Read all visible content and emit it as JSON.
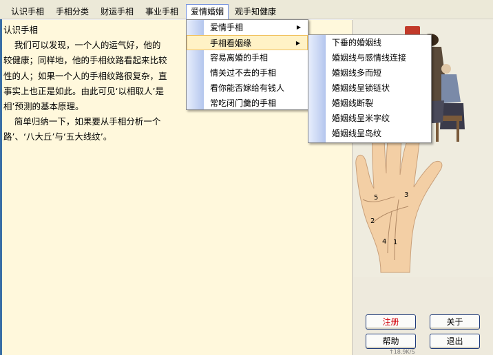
{
  "menubar": {
    "items": [
      {
        "label": "认识手相"
      },
      {
        "label": "手相分类"
      },
      {
        "label": "财运手相"
      },
      {
        "label": "事业手相"
      },
      {
        "label": "爱情婚姻"
      },
      {
        "label": "观手知健康"
      }
    ],
    "active_index": 4
  },
  "document": {
    "title": "认识手相",
    "lines": [
      "    我们可以发现，一个人的运气好，他的",
      "较健康；同样地，他的手相纹路看起来比较",
      "性的人；如果一个人的手相纹路很复杂，直",
      "事实上也正是如此。由此可见‘以相取人’是",
      "相’预测的基本原理。",
      "    简单归纳一下，如果要从手相分析一个",
      "路’、‘八大丘’与‘五大线纹’。"
    ]
  },
  "love_menu": {
    "items": [
      {
        "label": "爱情手相",
        "has_submenu": true
      },
      {
        "label": "手相看姻缘",
        "has_submenu": true,
        "highlighted": true
      },
      {
        "label": "容易离婚的手相",
        "has_submenu": false
      },
      {
        "label": "情关过不去的手相",
        "has_submenu": false
      },
      {
        "label": "看你能否嫁给有钱人",
        "has_submenu": false
      },
      {
        "label": "常吃闭门羹的手相",
        "has_submenu": false
      }
    ]
  },
  "marriage_submenu": {
    "items": [
      {
        "label": "下垂的婚姻线"
      },
      {
        "label": "婚姻线与感情线连接"
      },
      {
        "label": "婚姻线多而短"
      },
      {
        "label": "婚姻线呈锁链状"
      },
      {
        "label": "婚姻线断裂"
      },
      {
        "label": "婚姻线呈米字纹"
      },
      {
        "label": "婚姻线呈岛纹"
      }
    ]
  },
  "palm": {
    "line_numbers": [
      "1",
      "2",
      "3",
      "4",
      "5"
    ]
  },
  "buttons": {
    "register": "注册",
    "about": "关于",
    "help": "帮助",
    "exit": "退出"
  },
  "status": {
    "speed": "18.9K/S"
  },
  "icons": {
    "submenu_arrow": "triangle-right-icon"
  },
  "colors": {
    "doc_background": "#fff8dc",
    "menubar": "#ece9d8",
    "highlight": "#fff2c6",
    "register_text": "#d2000a"
  }
}
